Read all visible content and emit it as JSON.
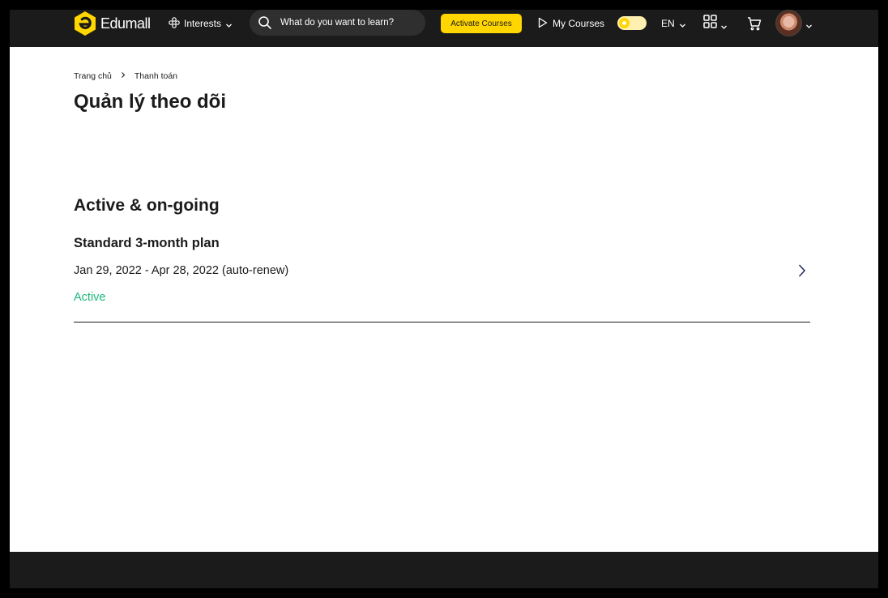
{
  "nav": {
    "logo_text": "Edumall",
    "interests_label": "Interests",
    "search_placeholder": "What do you want to learn?",
    "activate_label": "Activate Courses",
    "my_courses_label": "My Courses",
    "language": "EN",
    "brand_color": "#ffd600"
  },
  "breadcrumb": {
    "home": "Trang chủ",
    "current": "Thanh toán"
  },
  "page": {
    "title": "Quản lý theo dõi"
  },
  "subscriptions": {
    "section_title": "Active & on-going",
    "plan": {
      "name": "Standard 3-month plan",
      "dates": "Jan 29, 2022 - Apr 28, 2022 (auto-renew)",
      "status": "Active",
      "status_color": "#1db77a"
    }
  },
  "icons": [
    "logo-icon",
    "interests-icon",
    "chevron-down-icon",
    "search-icon",
    "play-icon",
    "theme-toggle-icon",
    "grid-icon",
    "cart-icon",
    "avatar",
    "chevron-right-icon"
  ]
}
